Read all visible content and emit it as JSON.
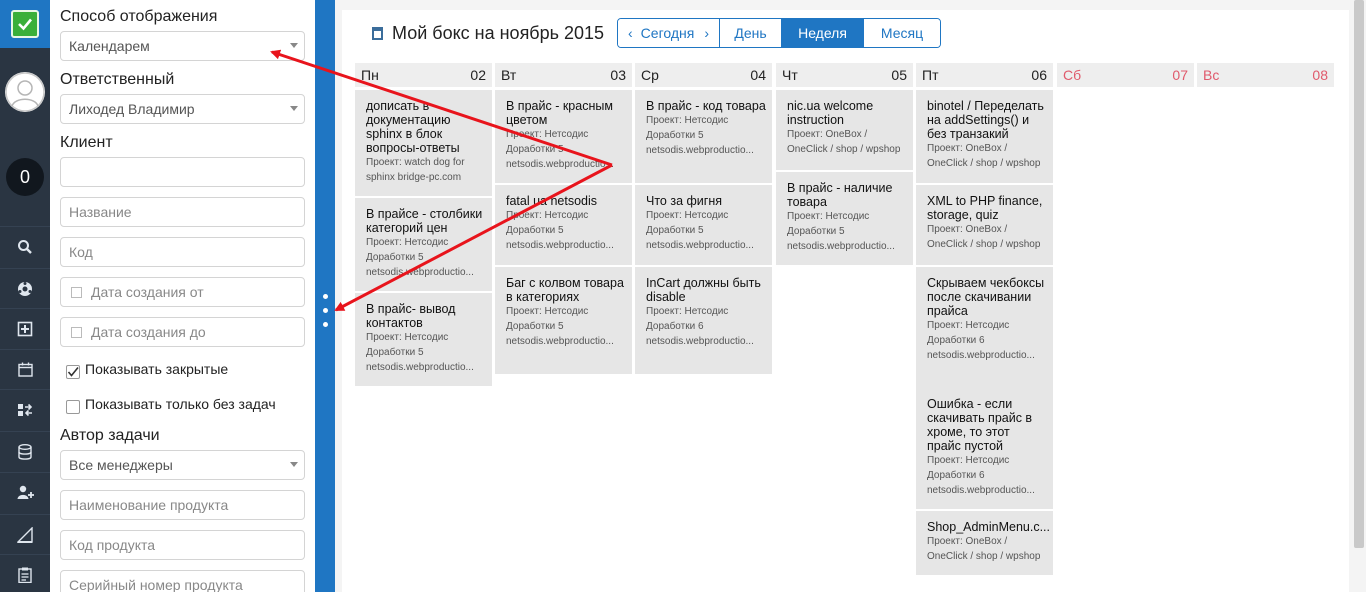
{
  "nav": {
    "counter": "0",
    "icons": [
      "search-icon",
      "soccer-ball-icon",
      "add-square-icon",
      "calendar-icon",
      "exchange-icon",
      "database-icon",
      "add-user-icon",
      "triangle-ruler-icon",
      "clipboard-icon"
    ]
  },
  "filters": {
    "display_mode_label": "Способ отображения",
    "display_mode_value": "Календарем",
    "responsible_label": "Ответственный",
    "responsible_value": "Лиходед Владимир",
    "client_label": "Клиент",
    "client_value": "",
    "name_placeholder": "Название",
    "code_placeholder": "Код",
    "date_from_placeholder": "Дата создания от",
    "date_to_placeholder": "Дата создания до",
    "show_closed_label": "Показывать закрытые",
    "show_closed_checked": true,
    "show_without_tasks_label": "Показывать только без задач",
    "show_without_tasks_checked": false,
    "author_label": "Автор задачи",
    "author_value": "Все менеджеры",
    "product_name_placeholder": "Наименование продукта",
    "product_code_placeholder": "Код продукта",
    "serial_placeholder": "Серийный номер продукта"
  },
  "calendar": {
    "title": "Мой бокс на ноябрь 2015",
    "prev_arrow": "‹",
    "today_label": "Сегодня",
    "next_arrow": "›",
    "day_label": "День",
    "week_label": "Неделя",
    "month_label": "Месяц",
    "active_view": "Неделя",
    "days": [
      {
        "name": "Пн",
        "date": "02",
        "weekend": false,
        "tasks": [
          {
            "title": "дописать в документацию sphinx в блок вопросы-ответы",
            "meta": [
              "Проект: watch dog for",
              "sphinx bridge-pc.com"
            ]
          },
          {
            "title": "В прайсе - столбики категорий цен",
            "meta": [
              "Проект: Нетсодис",
              "Доработки 5",
              "netsodis.webproductio..."
            ]
          },
          {
            "title": "В прайс- вывод контактов",
            "meta": [
              "Проект: Нетсодис",
              "Доработки 5",
              "netsodis.webproductio..."
            ]
          }
        ]
      },
      {
        "name": "Вт",
        "date": "03",
        "weekend": false,
        "tasks": [
          {
            "title": "В прайс - красным цветом",
            "meta": [
              "Проект: Нетсодис",
              "Доработки 5",
              "netsodis.webproductio..."
            ]
          },
          {
            "title": "fatal ua netsodis",
            "meta": [
              "Проект: Нетсодис",
              "Доработки 5",
              "netsodis.webproductio..."
            ]
          },
          {
            "title": "Баг с колвом товара в категориях",
            "meta": [
              "Проект: Нетсодис",
              "Доработки 5",
              "netsodis.webproductio..."
            ]
          }
        ]
      },
      {
        "name": "Ср",
        "date": "04",
        "weekend": false,
        "tasks": [
          {
            "title": "В прайс - код товара",
            "meta": [
              "Проект: Нетсодис",
              "Доработки 5",
              "netsodis.webproductio..."
            ]
          },
          {
            "title": "Что за фигня",
            "meta": [
              "Проект: Нетсодис",
              "Доработки 5",
              "netsodis.webproductio..."
            ]
          },
          {
            "title": "InCart должны быть disable",
            "meta": [
              "Проект: Нетсодис",
              "Доработки 6",
              "netsodis.webproductio..."
            ]
          }
        ]
      },
      {
        "name": "Чт",
        "date": "05",
        "weekend": false,
        "tasks": [
          {
            "title": "nic.ua welcome instruction",
            "meta": [
              "Проект: OneBox /",
              "OneClick / shop / wpshop"
            ]
          },
          {
            "title": "В прайс - наличие товара",
            "meta": [
              "Проект: Нетсодис",
              "Доработки 5",
              "netsodis.webproductio..."
            ]
          }
        ]
      },
      {
        "name": "Пт",
        "date": "06",
        "weekend": false,
        "tasks": [
          {
            "title": "binotel / Переделать на addSettings() и без транзакий",
            "meta": [
              "Проект: OneBox /",
              "OneClick / shop / wpshop"
            ]
          },
          {
            "title": "XML to PHP finance, storage, quiz",
            "meta": [
              "Проект: OneBox /",
              "OneClick / shop / wpshop"
            ]
          },
          {
            "title": "Скрываем чекбоксы после скачивании прайса",
            "meta": [
              "Проект: Нетсодис",
              "Доработки 6",
              "netsodis.webproductio..."
            ]
          },
          {
            "title": "Ошибка - если скачивать прайс в хроме, то этот прайс пустой",
            "meta": [
              "Проект: Нетсодис",
              "Доработки 6",
              "netsodis.webproductio..."
            ]
          },
          {
            "title": "Shop_AdminMenu.c...",
            "meta": [
              "Проект: OneBox /",
              "OneClick / shop / wpshop"
            ]
          }
        ]
      },
      {
        "name": "Сб",
        "date": "07",
        "weekend": true,
        "tasks": []
      },
      {
        "name": "Вс",
        "date": "08",
        "weekend": true,
        "tasks": []
      }
    ]
  },
  "colors": {
    "nav_bg": "#2a3542",
    "accent_blue": "#1f76c3",
    "logo_green": "#3aaf3a",
    "weekend_red": "#e05a6c",
    "task_bg": "#e6e6e6",
    "annotation_red": "#e8141c"
  }
}
